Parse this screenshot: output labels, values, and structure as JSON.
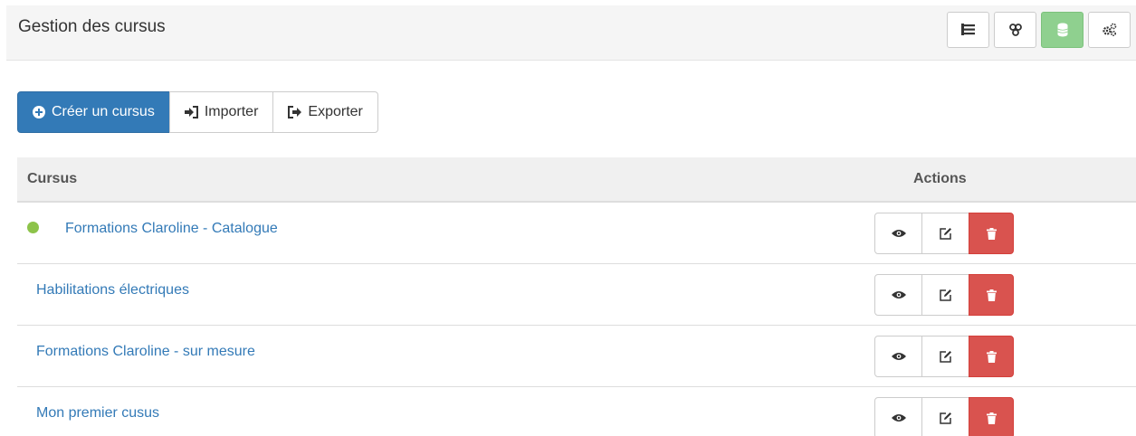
{
  "header": {
    "title": "Gestion des cursus",
    "tools": [
      {
        "icon": "list-icon",
        "active": false
      },
      {
        "icon": "users-icon",
        "active": false
      },
      {
        "icon": "database-icon",
        "active": true
      },
      {
        "icon": "cogs-icon",
        "active": false
      }
    ]
  },
  "toolbar": {
    "create_label": "Créer un cursus",
    "import_label": "Importer",
    "export_label": "Exporter"
  },
  "table": {
    "headers": {
      "cursus": "Cursus",
      "actions": "Actions"
    },
    "rows": [
      {
        "name": "Formations Claroline - Catalogue",
        "status_color": "#8dc34a"
      },
      {
        "name": "Habilitations électriques"
      },
      {
        "name": "Formations Claroline - sur mesure"
      },
      {
        "name": "Mon premier cusus"
      }
    ]
  },
  "colors": {
    "primary": "#337ab7",
    "danger": "#d9534f",
    "success": "#8fd08f",
    "status": "#8dc34a"
  }
}
